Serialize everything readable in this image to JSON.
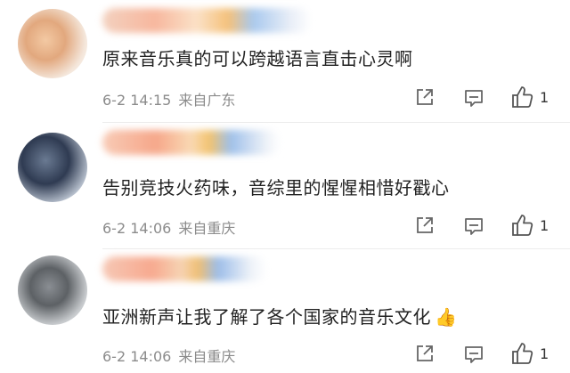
{
  "comments": [
    {
      "text": "原来音乐真的可以跨越语言直击心灵啊",
      "date": "6-2 14:15",
      "location": "来自广东",
      "likes": "1",
      "emoji": ""
    },
    {
      "text": "告别竞技火药味，音综里的惺惺相惜好戳心",
      "date": "6-2 14:06",
      "location": "来自重庆",
      "likes": "1",
      "emoji": ""
    },
    {
      "text": "亚洲新声让我了解了各个国家的音乐文化",
      "date": "6-2 14:06",
      "location": "来自重庆",
      "likes": "1",
      "emoji": "👍"
    }
  ],
  "icons": {
    "share": "share-icon",
    "comment": "comment-icon",
    "like": "thumbs-up-icon"
  }
}
